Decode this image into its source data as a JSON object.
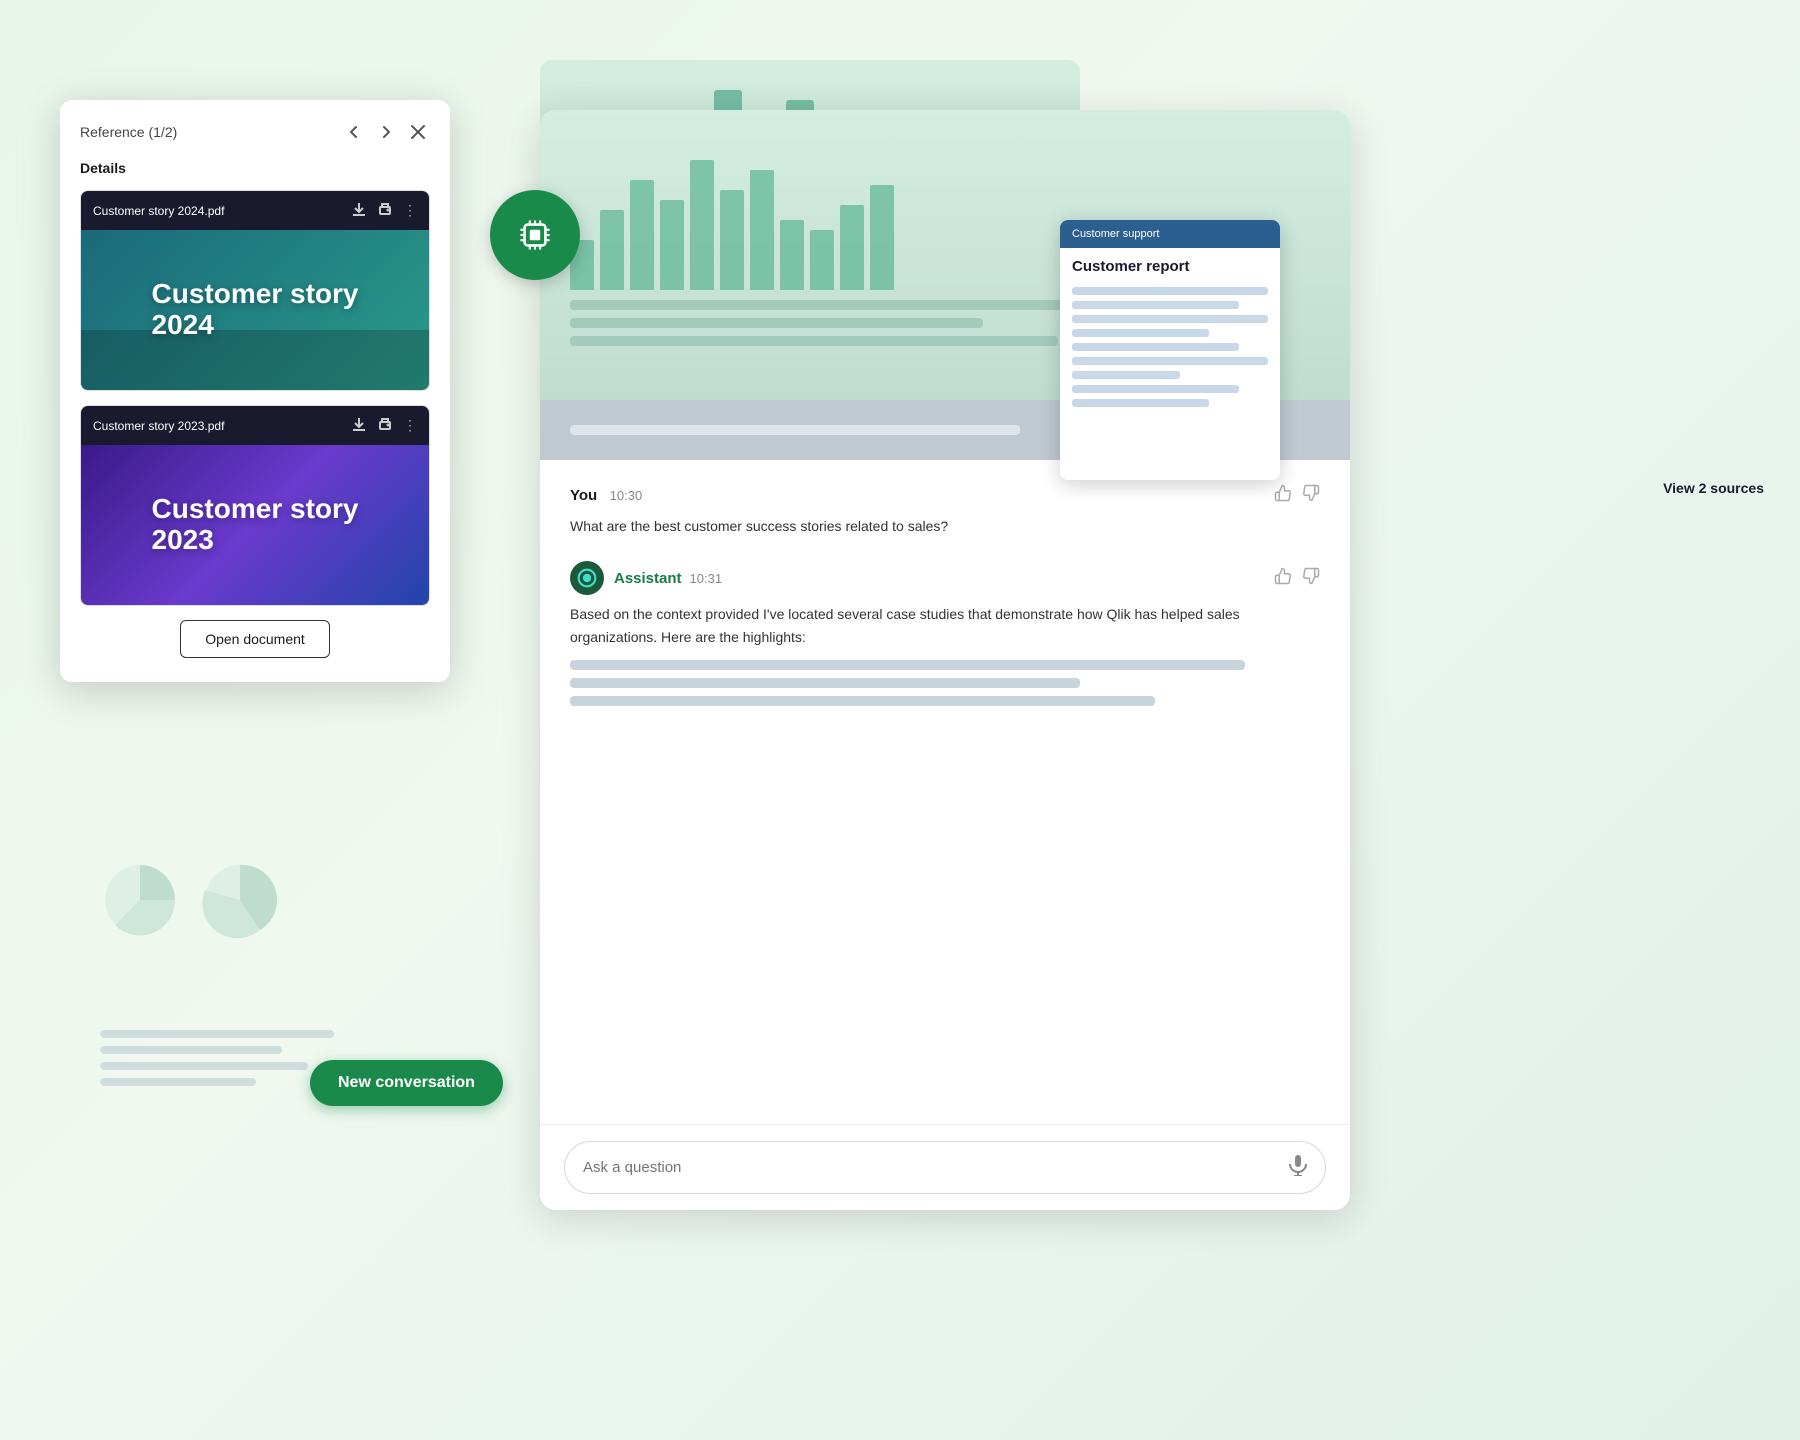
{
  "background": {
    "color": "#e8f5ee"
  },
  "ref_panel": {
    "title": "Reference (1/2)",
    "nav_prev": "‹",
    "nav_next": "›",
    "close": "×",
    "details_label": "Details",
    "doc1": {
      "name": "Customer story 2024.pdf",
      "thumb_line1": "Customer story",
      "thumb_line2": "2024"
    },
    "doc2": {
      "name": "Customer story 2023.pdf",
      "thumb_line1": "Customer story",
      "thumb_line2": "2023"
    },
    "open_doc_btn": "Open document"
  },
  "report_card": {
    "header": "Customer support",
    "title": "Customer report"
  },
  "view_sources": "View 2 sources",
  "chat": {
    "message1": {
      "sender": "You",
      "time": "10:30",
      "text": "What are the best customer success stories related to sales?"
    },
    "message2": {
      "sender": "Assistant",
      "time": "10:31",
      "avatar_icon": "●",
      "text": "Based on the context provided I've located several case studies that demonstrate how Qlik has helped sales organizations. Here are the highlights:"
    },
    "input_placeholder": "Ask a question"
  },
  "new_conv_btn": "New conversation",
  "ai_icon": {
    "label": "AI"
  },
  "thumbs": {
    "up": "👍",
    "down": "👎",
    "like_symbol": "▲",
    "dislike_symbol": "▼"
  }
}
